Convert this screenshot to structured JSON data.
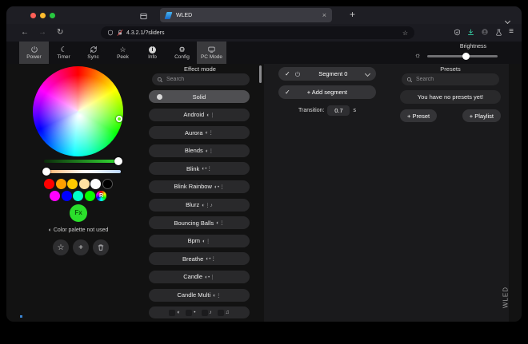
{
  "browser": {
    "traffic_lights": [
      "#ff5f57",
      "#febc2e",
      "#28c840"
    ],
    "tab": {
      "title": "WLED"
    },
    "url": "4.3.2.1/?sliders"
  },
  "icons": {
    "close": "×",
    "new_tab": "+",
    "back": "←",
    "forward": "→",
    "reload": "↻",
    "menu": "≡",
    "bookmark_star": "☆",
    "moon": "☾",
    "star": "☆",
    "gear": "⚙",
    "info": "i",
    "sun": "☼",
    "check": "✓",
    "plus": "+",
    "palette": "◐"
  },
  "toolbar": {
    "tabs": [
      {
        "label": "Power",
        "active": true
      },
      {
        "label": "Timer",
        "active": false
      },
      {
        "label": "Sync",
        "active": false
      },
      {
        "label": "Peek",
        "active": false
      },
      {
        "label": "Info",
        "active": false
      },
      {
        "label": "Config",
        "active": false
      },
      {
        "label": "PC Mode",
        "active": true
      }
    ],
    "brightness": {
      "label": "Brightness",
      "value_pct": 50
    }
  },
  "color_panel": {
    "picker_position": "right-green",
    "value_slider": {
      "gradient": "linear-gradient(90deg,#0b2a0b,#35e435)",
      "value_pct": 97
    },
    "white_slider": {
      "gradient": "linear-gradient(90deg,#ffb066,#ffffff 55%,#bdd8ff)",
      "value_pct": 2
    },
    "swatches_row1": [
      "#ff0000",
      "#ffa000",
      "#ffc800",
      "#ffe0a0",
      "#ffffff",
      "#000000"
    ],
    "swatches_row2": [
      "#ff00ff",
      "#0000ff",
      "#00ffc8",
      "#08ff00",
      "conic-gradient(#ff0000,#ffff00,#00ff00,#00ffff,#0000ff,#ff00ff,#ff0000)"
    ],
    "random_swatch_label": "R",
    "fx_button_label": "Fx",
    "palette_status": "Color palette not used"
  },
  "effects": {
    "title": "Effect mode",
    "search_placeholder": "Search",
    "items": [
      {
        "name": "Solid",
        "flags": "",
        "selected": true
      },
      {
        "name": "Android",
        "flags": "◐⋮",
        "selected": false
      },
      {
        "name": "Aurora",
        "flags": "◐⋮",
        "selected": false
      },
      {
        "name": "Blends",
        "flags": "◐⋮",
        "selected": false
      },
      {
        "name": "Blink",
        "flags": "◐•⋮",
        "selected": false
      },
      {
        "name": "Blink Rainbow",
        "flags": "◐•⋮",
        "selected": false
      },
      {
        "name": "Blurz",
        "flags": "◐⋮♪",
        "selected": false
      },
      {
        "name": "Bouncing Balls",
        "flags": "◐⋮",
        "selected": false
      },
      {
        "name": "Bpm",
        "flags": "◐⋮",
        "selected": false
      },
      {
        "name": "Breathe",
        "flags": "◐•⋮",
        "selected": false
      },
      {
        "name": "Candle",
        "flags": "◐•⋮",
        "selected": false
      },
      {
        "name": "Candle Multi",
        "flags": "◐⋮",
        "selected": false
      }
    ],
    "filter_icons": [
      "◐",
      "•",
      "♪",
      "♫"
    ]
  },
  "segments": {
    "segment_name": "Segment 0",
    "add_button": "+ Add segment",
    "transition": {
      "label": "Transition:",
      "value": "0.7",
      "unit": "s"
    }
  },
  "presets": {
    "title": "Presets",
    "search_placeholder": "Search",
    "empty_message": "You have no presets yet!",
    "add_preset": "+ Preset",
    "add_playlist": "+ Playlist"
  },
  "watermark": "WLED"
}
